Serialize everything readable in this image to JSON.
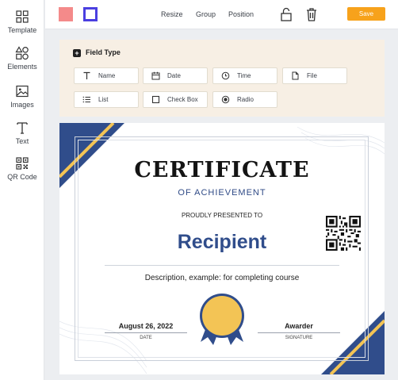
{
  "sidebar": {
    "items": [
      {
        "label": "Template",
        "icon": "template-icon"
      },
      {
        "label": "Elements",
        "icon": "elements-icon"
      },
      {
        "label": "Images",
        "icon": "image-icon"
      },
      {
        "label": "Text",
        "icon": "text-icon"
      },
      {
        "label": "QR Code",
        "icon": "qr-code-icon"
      }
    ]
  },
  "toolbar": {
    "swatch_fill_color": "#f48a8a",
    "swatch_border_color": "#4a3fe0",
    "resize_label": "Resize",
    "group_label": "Group",
    "position_label": "Position",
    "save_label": "Save",
    "save_color": "#f7a21b"
  },
  "field_panel": {
    "title": "Field Type",
    "background": "#f7efe4",
    "fields": [
      {
        "label": "Name",
        "icon": "text-field-icon"
      },
      {
        "label": "Date",
        "icon": "calendar-icon"
      },
      {
        "label": "Time",
        "icon": "clock-icon"
      },
      {
        "label": "File",
        "icon": "file-icon"
      },
      {
        "label": "List",
        "icon": "list-icon"
      },
      {
        "label": "Check Box",
        "icon": "checkbox-icon"
      },
      {
        "label": "Radio",
        "icon": "radio-icon"
      }
    ]
  },
  "certificate": {
    "title": "CERTIFICATE",
    "subtitle": "OF ACHIEVEMENT",
    "presented_to": "PROUDLY PRESENTED TO",
    "recipient": "Recipient",
    "description": "Description, example: for completing course",
    "date_value": "August 26, 2022",
    "date_label": "DATE",
    "awarder": "Awarder",
    "signature_label": "SIGNATURE",
    "accent_color": "#304d8b",
    "gold_color": "#f3c455"
  }
}
